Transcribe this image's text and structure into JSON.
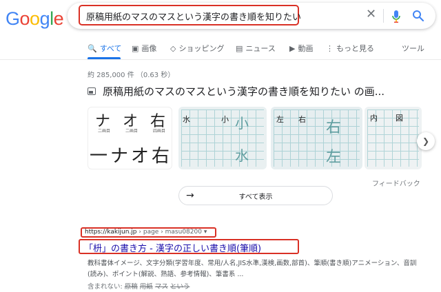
{
  "logo": {
    "letters": [
      "G",
      "o",
      "o",
      "g",
      "l",
      "e"
    ],
    "colors": [
      "#4285f4",
      "#ea4335",
      "#fbbc05",
      "#4285f4",
      "#34a853",
      "#ea4335"
    ]
  },
  "search": {
    "query": "原稿用紙のマスのマスという漢字の書き順を知りたい",
    "highlight_color": "#d93025"
  },
  "tabs": [
    {
      "icon": "search-icon",
      "glyph": "🔍",
      "label": "すべて",
      "active": true
    },
    {
      "icon": "image-icon",
      "glyph": "▣",
      "label": "画像"
    },
    {
      "icon": "tag-icon",
      "glyph": "◇",
      "label": "ショッピング"
    },
    {
      "icon": "news-icon",
      "glyph": "▤",
      "label": "ニュース"
    },
    {
      "icon": "video-icon",
      "glyph": "▶",
      "label": "動画"
    },
    {
      "icon": "more-icon",
      "glyph": "⋮",
      "label": "もっと見る"
    }
  ],
  "tools_label": "ツール",
  "result_stats": "約 285,000 件 （0.63 秒）",
  "images": {
    "heading": "原稿用紙のマスのマスという漢字の書き順を知りたい の画...",
    "thumb1": {
      "top": [
        "ナ",
        "オ",
        "右"
      ],
      "captions": [
        "二画目",
        "二画目",
        "四画目"
      ],
      "bottom": [
        "一",
        "ナ",
        "オ",
        "右"
      ]
    },
    "thumb2": {
      "chars": [
        "水",
        "小",
        "小",
        "水"
      ]
    },
    "thumb3": {
      "chars": [
        "左",
        "右",
        "右",
        "左"
      ]
    },
    "thumb4": {
      "chars": [
        "内",
        "図"
      ]
    },
    "feedback": "フィードバック",
    "show_all": "すべて表示"
  },
  "result": {
    "cite_host": "https://kakijun.jp",
    "cite_path": " › page › masu08200",
    "title": "「枡」の書き方 - 漢字の正しい書き順(筆順)",
    "snippet": "教科書体イメージ、文字分類(学習年度、常用/人名,JIS水準,漢検,画数,部首)、筆順(書き順)アニメーション、音訓(読み)、ポイント(解説、熟語、参考情報)、筆書系 ...",
    "missing_label": "含まれない: ",
    "missing_terms": [
      "原稿",
      "用紙",
      "マス",
      "という"
    ]
  }
}
